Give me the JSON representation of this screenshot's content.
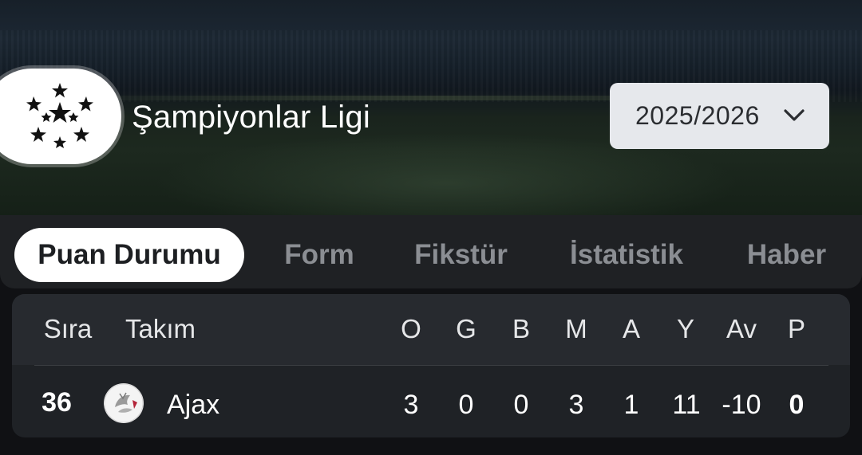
{
  "league": {
    "name": "Şampiyonlar Ligi",
    "logo_icon": "champions-league-starball-icon"
  },
  "season": {
    "selected": "2025/2026",
    "icon": "chevron-down-icon"
  },
  "tabs": [
    {
      "label": "Puan Durumu",
      "active": true
    },
    {
      "label": "Form",
      "active": false
    },
    {
      "label": "Fikstür",
      "active": false
    },
    {
      "label": "İstatistik",
      "active": false
    },
    {
      "label": "Haber",
      "active": false
    }
  ],
  "table": {
    "headers": {
      "rank": "Sıra",
      "team": "Takım",
      "played": "O",
      "won": "G",
      "drawn": "B",
      "lost": "M",
      "goals_for": "A",
      "goals_against": "Y",
      "goal_diff": "Av",
      "points": "P"
    },
    "rows": [
      {
        "rank": "36",
        "team": "Ajax",
        "team_icon": "ajax-crest-icon",
        "played": "3",
        "won": "0",
        "drawn": "0",
        "lost": "3",
        "goals_for": "1",
        "goals_against": "11",
        "goal_diff": "-10",
        "points": "0"
      }
    ]
  },
  "colors": {
    "tab_active_bg": "#ffffff",
    "tab_inactive_text": "#8b8e93",
    "table_header_bg": "#272a2f",
    "table_bg": "#1f2226"
  }
}
